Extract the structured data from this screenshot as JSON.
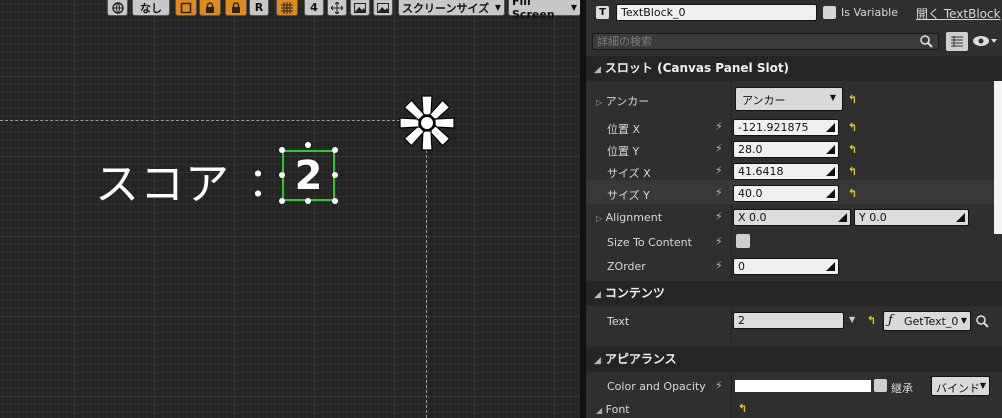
{
  "toolbar": {
    "locale_label": "なし",
    "r_label": "R",
    "grid_size": "4",
    "screen_size": "スクリーンサイズ",
    "fill_mode": "Fill Screen"
  },
  "canvas": {
    "score_label": "スコア",
    "colon": "：",
    "score_value": "2"
  },
  "header": {
    "widget_name": "TextBlock_0",
    "is_variable_label": "Is Variable",
    "open_link": "開く TextBlock",
    "search_placeholder": "詳細の検索"
  },
  "slot": {
    "title": "スロット (Canvas Panel Slot)",
    "anchor_label": "アンカー",
    "anchor_value": "アンカー",
    "pos_x_label": "位置 X",
    "pos_x_value": "-121.921875",
    "pos_y_label": "位置 Y",
    "pos_y_value": "28.0",
    "size_x_label": "サイズ X",
    "size_x_value": "41.6418",
    "size_y_label": "サイズ Y",
    "size_y_value": "40.0",
    "alignment_label": "Alignment",
    "alignment_x": "X  0.0",
    "alignment_y": "Y  0.0",
    "size_to_content_label": "Size To Content",
    "zorder_label": "ZOrder",
    "zorder_value": "0"
  },
  "content": {
    "title": "コンテンツ",
    "text_label": "Text",
    "text_value": "2",
    "binding_label": "GetText_0"
  },
  "appearance": {
    "title": "アピアランス",
    "color_label": "Color and Opacity",
    "inherit_label": "継承",
    "bind_label": "バインド",
    "font_label": "Font"
  },
  "colors": {
    "accent_orange": "#e08a1c",
    "selection_green": "#23d21f",
    "reset_yellow": "#e2cc1f"
  }
}
